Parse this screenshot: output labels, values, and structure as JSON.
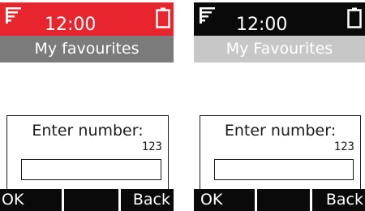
{
  "screens": [
    {
      "status": {
        "time": "12:00",
        "signal_icon": "signal-strength-icon",
        "battery_icon": "battery-icon"
      },
      "title": "My favourites",
      "dialog": {
        "prompt": "Enter number:",
        "entered_value": "123",
        "field_value": ""
      },
      "softkeys": {
        "left": "OK",
        "middle": "",
        "right": "Back"
      },
      "colors": {
        "status_bar": "#e8242c",
        "title_bar": "#7b7b7b",
        "softkey": "#0a0a0a"
      }
    },
    {
      "status": {
        "time": "12:00",
        "signal_icon": "signal-strength-icon",
        "battery_icon": "battery-icon"
      },
      "title": "My Favourites",
      "dialog": {
        "prompt": "Enter number:",
        "entered_value": "123",
        "field_value": ""
      },
      "softkeys": {
        "left": "OK",
        "middle": "",
        "right": "Back"
      },
      "colors": {
        "status_bar": "#0a0a0a",
        "title_bar": "#c7c7c7",
        "softkey": "#0a0a0a"
      }
    }
  ]
}
